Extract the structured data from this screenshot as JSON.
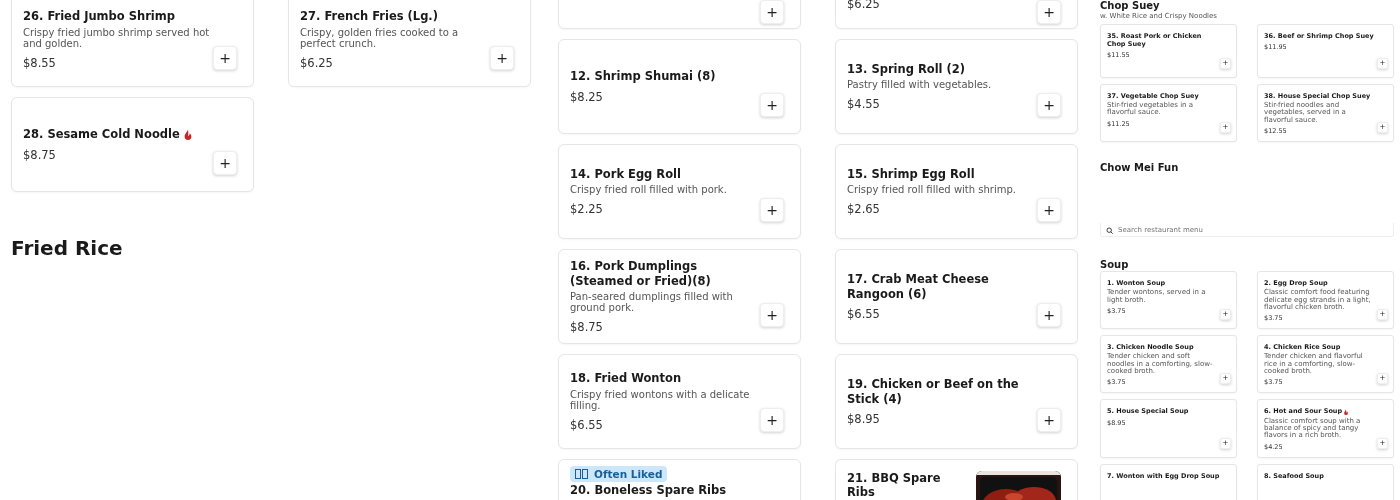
{
  "columns": [
    {
      "kind": "full",
      "blocks": [
        {
          "kind": "cards",
          "items": [
            {
              "name": "26. Fried Jumbo Shrimp",
              "description": "Crispy fried jumbo shrimp served hot and golden.",
              "price": "$8.55",
              "add": "+"
            },
            {
              "name": "27. French Fries (Lg.)",
              "description": "Crispy, golden fries cooked to a perfect crunch.",
              "price": "$6.25",
              "add": "+"
            },
            {
              "name": "28. Sesame Cold Noodle",
              "spicy": true,
              "price": "$8.75",
              "add": "+"
            }
          ]
        },
        {
          "kind": "heading",
          "text": "Fried Rice"
        }
      ]
    },
    {
      "kind": "full",
      "blocks": [
        {
          "kind": "cards",
          "items": [
            {
              "add": "+"
            },
            {
              "price": "$6.25",
              "add": "+"
            },
            {
              "name": "12. Shrimp Shumai (8)",
              "price": "$8.25",
              "add": "+"
            },
            {
              "name": "13. Spring Roll (2)",
              "description": "Pastry filled with vegetables.",
              "price": "$4.55",
              "add": "+"
            },
            {
              "name": "14. Pork Egg Roll",
              "description": "Crispy fried roll filled with pork.",
              "price": "$2.25",
              "add": "+"
            },
            {
              "name": "15. Shrimp Egg Roll",
              "description": "Crispy fried roll filled with shrimp.",
              "price": "$2.65",
              "add": "+"
            },
            {
              "name": "16. Pork Dumplings (Steamed or Fried)(8)",
              "description": "Pan-seared dumplings filled with ground pork.",
              "price": "$8.75",
              "add": "+"
            },
            {
              "name": "17. Crab Meat Cheese Rangoon (6)",
              "price": "$6.55",
              "add": "+"
            },
            {
              "name": "18. Fried Wonton",
              "description": "Crispy fried wontons with a delicate filling.",
              "price": "$6.55",
              "add": "+"
            },
            {
              "name": "19. Chicken or Beef on the Stick (4)",
              "price": "$8.95",
              "add": "+"
            },
            {
              "badge": "Often Liked",
              "name": "20. Boneless Spare Ribs"
            },
            {
              "name": "21. BBQ Spare Ribs",
              "picture": true
            }
          ]
        }
      ]
    },
    {
      "kind": "mini",
      "blocks": [
        {
          "kind": "heading",
          "text": "Chop Suey"
        },
        {
          "kind": "subtitle",
          "text": "w. White Rice and Crispy Noodles"
        },
        {
          "kind": "cards",
          "items": [
            {
              "name": "35. Roast Pork or Chicken Chop Suey",
              "price": "$11.55",
              "add": "+"
            },
            {
              "name": "36. Beef or Shrimp Chop Suey",
              "price": "$11.95",
              "add": "+"
            },
            {
              "name": "37. Vegetable Chop Suey",
              "description": "Stir-fried vegetables in a flavorful sauce.",
              "price": "$11.25",
              "add": "+"
            },
            {
              "name": "38. House Special Chop Suey",
              "description": "Stir-fried noodles and vegetables, served in a flavorful sauce.",
              "price": "$12.55",
              "add": "+"
            }
          ]
        },
        {
          "kind": "heading",
          "text": "Chow Mei Fun"
        },
        {
          "kind": "search",
          "placeholder": "Search restaurant menu"
        },
        {
          "kind": "heading",
          "text": "Soup"
        },
        {
          "kind": "cards",
          "items": [
            {
              "name": "1. Wonton Soup",
              "description": "Tender wontons, served in a light broth.",
              "price": "$3.75",
              "add": "+"
            },
            {
              "name": "2. Egg Drop Soup",
              "description": "Classic comfort food featuring delicate egg strands in a light, flavorful chicken broth.",
              "price": "$3.75",
              "add": "+"
            },
            {
              "name": "3. Chicken Noodle Soup",
              "description": "Tender chicken and soft noodles in a comforting, slow-cooked broth.",
              "price": "$3.75",
              "add": "+"
            },
            {
              "name": "4. Chicken Rice Soup",
              "description": "Tender chicken and flavorful rice in a comforting, slow-cooked broth.",
              "price": "$3.75",
              "add": "+"
            },
            {
              "name": "5. House Special Soup",
              "price": "$8.95",
              "add": "+"
            },
            {
              "name": "6. Hot and Sour Soup",
              "spicy": true,
              "description": "Classic comfort soup with a balance of spicy and tangy flavors in a rich broth.",
              "price": "$4.25",
              "add": "+"
            },
            {
              "name": "7. Wonton with Egg Drop Soup"
            },
            {
              "name": "8. Seafood Soup"
            }
          ]
        }
      ]
    }
  ]
}
